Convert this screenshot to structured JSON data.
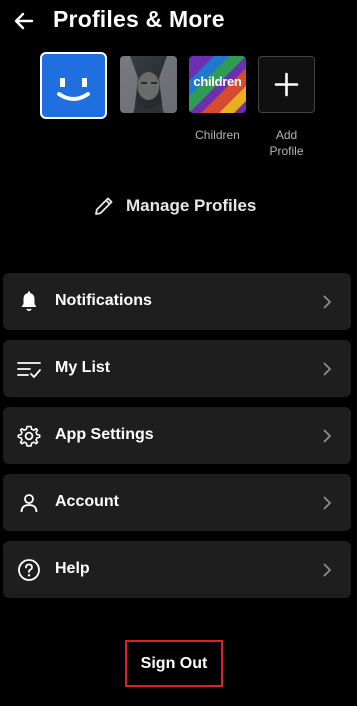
{
  "header": {
    "title": "Profiles & More",
    "back_icon": "arrow-left-icon"
  },
  "profiles": [
    {
      "label": "",
      "avatar": "smiley-blue-avatar",
      "selected": true
    },
    {
      "label": "",
      "avatar": "photo-avatar"
    },
    {
      "label": "Children",
      "avatar": "children-avatar",
      "avatar_text": "children"
    },
    {
      "label": "Add\nProfile",
      "avatar": "plus-icon"
    }
  ],
  "manage_profiles": {
    "label": "Manage Profiles",
    "icon": "pencil-icon"
  },
  "menu": [
    {
      "label": "Notifications",
      "icon": "bell-icon"
    },
    {
      "label": "My List",
      "icon": "list-check-icon"
    },
    {
      "label": "App Settings",
      "icon": "gear-icon"
    },
    {
      "label": "Account",
      "icon": "person-icon"
    },
    {
      "label": "Help",
      "icon": "help-circle-icon"
    }
  ],
  "sign_out": {
    "label": "Sign Out"
  },
  "colors": {
    "background": "#000000",
    "card": "#1e1e1e",
    "highlight": "#e11d2a",
    "selected_avatar": "#1f6fe0"
  }
}
